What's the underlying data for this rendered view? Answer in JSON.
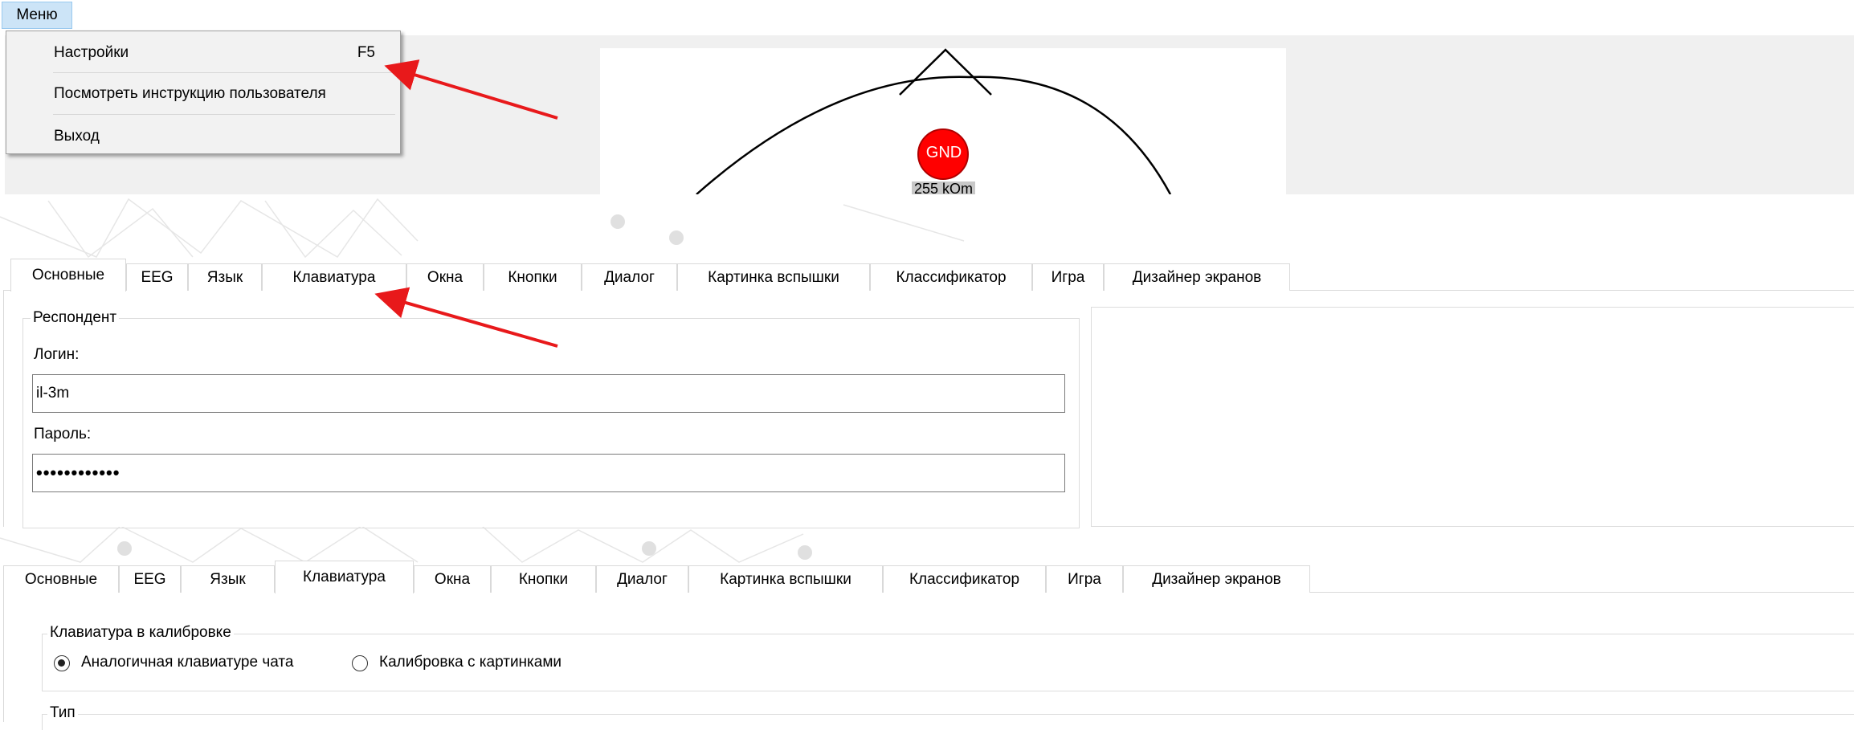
{
  "menu": {
    "title": "Меню",
    "items": [
      {
        "label": "Настройки",
        "shortcut": "F5"
      },
      {
        "label": "Посмотреть инструкцию пользователя",
        "shortcut": ""
      },
      {
        "label": "Выход",
        "shortcut": ""
      }
    ]
  },
  "electrode": {
    "label": "GND",
    "value": "255 kOm"
  },
  "tabs": [
    "Основные",
    "EEG",
    "Язык",
    "Клавиатура",
    "Окна",
    "Кнопки",
    "Диалог",
    "Картинка вспышки",
    "Классификатор",
    "Игра",
    "Дизайнер экранов"
  ],
  "main_tab": {
    "selected": "Основные",
    "group_title": "Респондент",
    "login_label": "Логин:",
    "login_value": "il-3m",
    "password_label": "Пароль:",
    "password_value": "••••••••••••"
  },
  "keyboard_tab": {
    "selected": "Клавиатура",
    "calibration_group_title": "Клавиатура в калибровке",
    "options": [
      {
        "label": "Аналогичная клавиатуре чата",
        "checked": true
      },
      {
        "label": "Калибровка с картинками",
        "checked": false
      }
    ],
    "type_group_title": "Тип"
  },
  "colors": {
    "highlight": "#cce4f7",
    "arrow": "#e8191b",
    "electrode": "#ff0000"
  }
}
